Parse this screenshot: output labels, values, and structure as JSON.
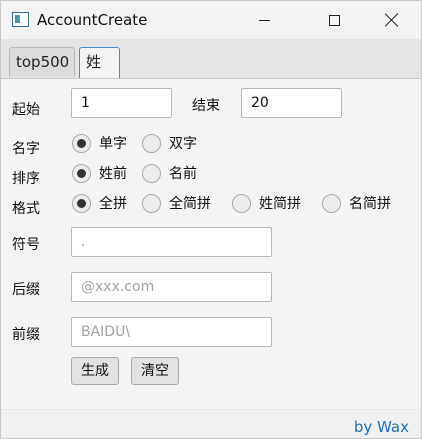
{
  "window": {
    "title": "AccountCreate"
  },
  "tabs": [
    {
      "label": "top500"
    },
    {
      "label": "姓氏"
    }
  ],
  "range": {
    "start_label": "起始",
    "start_value": "1",
    "end_label": "结束",
    "end_value": "20"
  },
  "name_type": {
    "label": "名字",
    "options": [
      "单字",
      "双字"
    ],
    "selected": "单字"
  },
  "order": {
    "label": "排序",
    "options": [
      "姓前",
      "名前"
    ],
    "selected": "姓前"
  },
  "format": {
    "label": "格式",
    "options": [
      "全拼",
      "全简拼",
      "姓简拼",
      "名简拼"
    ],
    "selected": "全拼"
  },
  "symbol": {
    "label": "符号",
    "placeholder": "."
  },
  "suffix": {
    "label": "后缀",
    "placeholder": "@xxx.com"
  },
  "prefix": {
    "label": "前缀",
    "placeholder": "BAIDU\\"
  },
  "actions": {
    "generate": "生成",
    "clear": "清空"
  },
  "footer": {
    "credit": "by Wax"
  }
}
